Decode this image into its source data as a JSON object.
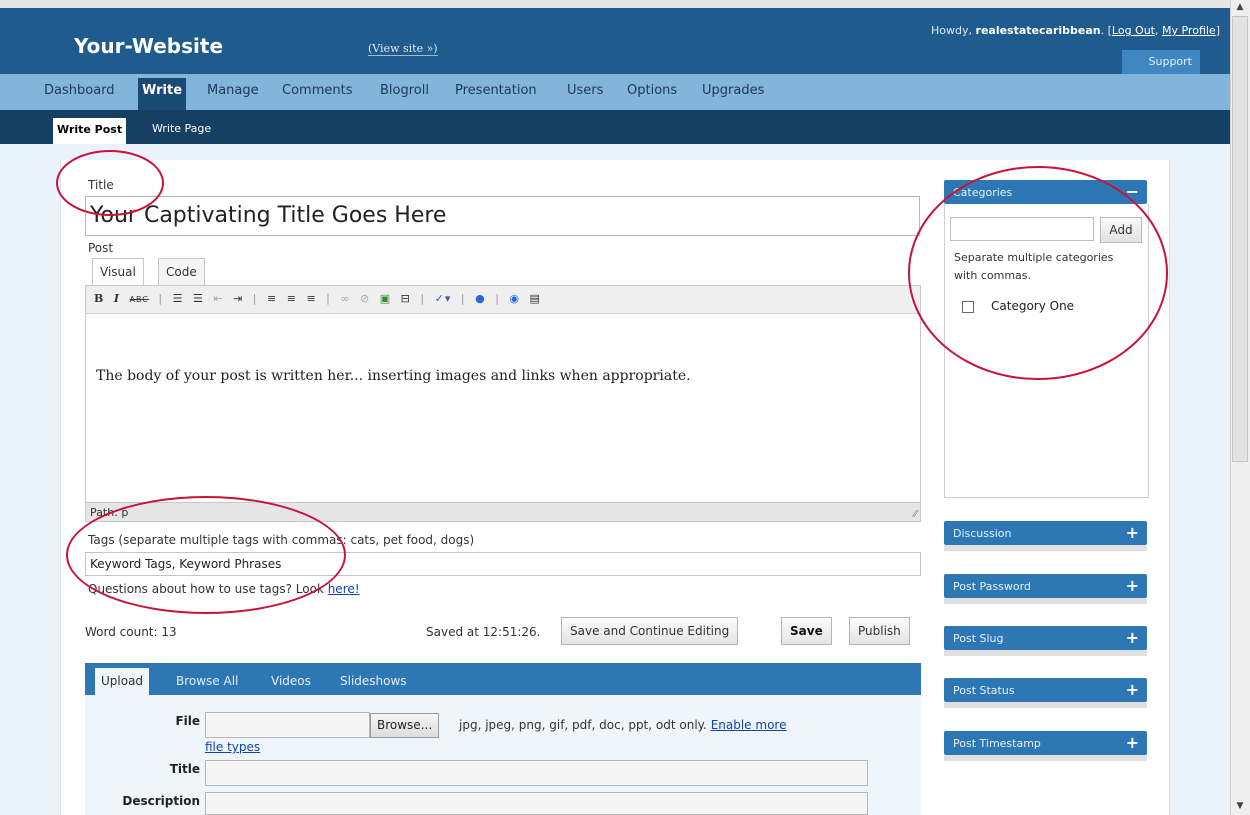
{
  "header": {
    "site_title": "Your-Website",
    "view_site": "(View site »)",
    "howdy": "Howdy,",
    "username": "realestatecaribbean",
    "logout": "Log Out",
    "profile": "My Profile",
    "support": "Support"
  },
  "nav": {
    "items": [
      "Dashboard",
      "Write",
      "Manage",
      "Comments",
      "Blogroll",
      "Presentation",
      "Users",
      "Options",
      "Upgrades"
    ],
    "active": "Write"
  },
  "subnav": {
    "items": [
      "Write Post",
      "Write Page"
    ],
    "active": "Write Post"
  },
  "post": {
    "title_label": "Title",
    "title_value": "Your Captivating Title Goes Here",
    "post_label": "Post",
    "tabs": [
      "Visual",
      "Code"
    ],
    "toolbar_icons": [
      "bold-icon",
      "italic-icon",
      "strikethrough-icon",
      "bullet-list-icon",
      "numbered-list-icon",
      "outdent-icon",
      "indent-icon",
      "align-left-icon",
      "align-center-icon",
      "align-right-icon",
      "link-icon",
      "unlink-icon",
      "image-icon",
      "more-icon",
      "spellcheck-icon",
      "help-icon",
      "wordpress-icon",
      "kitchen-sink-icon"
    ],
    "body_text": "The body of your post is written her... inserting images and links when appropriate.",
    "path": "Path: p"
  },
  "tags": {
    "label": "Tags (separate multiple tags with commas: cats, pet food, dogs)",
    "value": "Keyword Tags, Keyword Phrases",
    "help_prefix": "Questions about how to use tags? Look ",
    "help_link": "here!"
  },
  "status": {
    "word_count": "Word count: 13",
    "saved_at": "Saved at 12:51:26.",
    "save_continue": "Save and Continue Editing",
    "save": "Save",
    "publish": "Publish"
  },
  "upload": {
    "tabs": [
      "Upload",
      "Browse All",
      "Videos",
      "Slideshows"
    ],
    "file_label": "File",
    "browse": "Browse...",
    "file_types": "jpg, jpeg, png, gif, pdf, doc, ppt, odt only.",
    "enable_more": "Enable more",
    "enable_more_2": "file types",
    "title_label": "Title",
    "description_label": "Description"
  },
  "sidebar": {
    "categories": {
      "title": "Categories",
      "add": "Add",
      "hint": "Separate multiple categories with commas.",
      "items": [
        "Category One"
      ]
    },
    "boxes": [
      "Discussion",
      "Post Password",
      "Post Slug",
      "Post Status",
      "Post Timestamp"
    ]
  },
  "colors": {
    "header_blue": "#1f5b8c",
    "nav_light_blue": "#83b4da",
    "subnav_dark": "#153f63",
    "annotation_red": "#c8143c"
  }
}
